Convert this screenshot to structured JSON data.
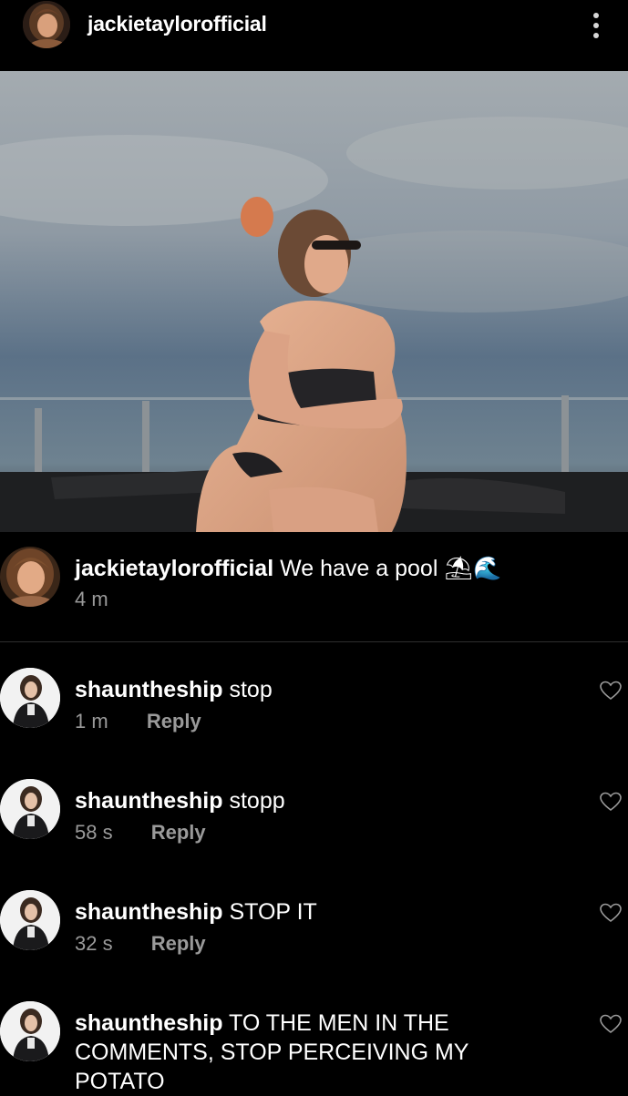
{
  "header": {
    "username": "jackietaylorofficial"
  },
  "caption": {
    "username": "jackietaylorofficial",
    "text": "We have a pool",
    "emojis": "⛱🌊",
    "time": "4 m"
  },
  "comments": [
    {
      "username": "shauntheship",
      "text": "stop",
      "time": "1 m",
      "reply_label": "Reply"
    },
    {
      "username": "shauntheship",
      "text": "stopp",
      "time": "58 s",
      "reply_label": "Reply"
    },
    {
      "username": "shauntheship",
      "text": "STOP IT",
      "time": "32 s",
      "reply_label": "Reply"
    },
    {
      "username": "shauntheship",
      "text": "TO THE MEN IN THE COMMENTS, STOP PERCEIVING MY POTATO"
    }
  ],
  "icons": {
    "more": "more-vertical-icon",
    "like": "heart-icon"
  },
  "colors": {
    "background": "#000000",
    "text_primary": "#ffffff",
    "text_secondary": "#9a9a9a",
    "divider": "#2e2e2e"
  }
}
